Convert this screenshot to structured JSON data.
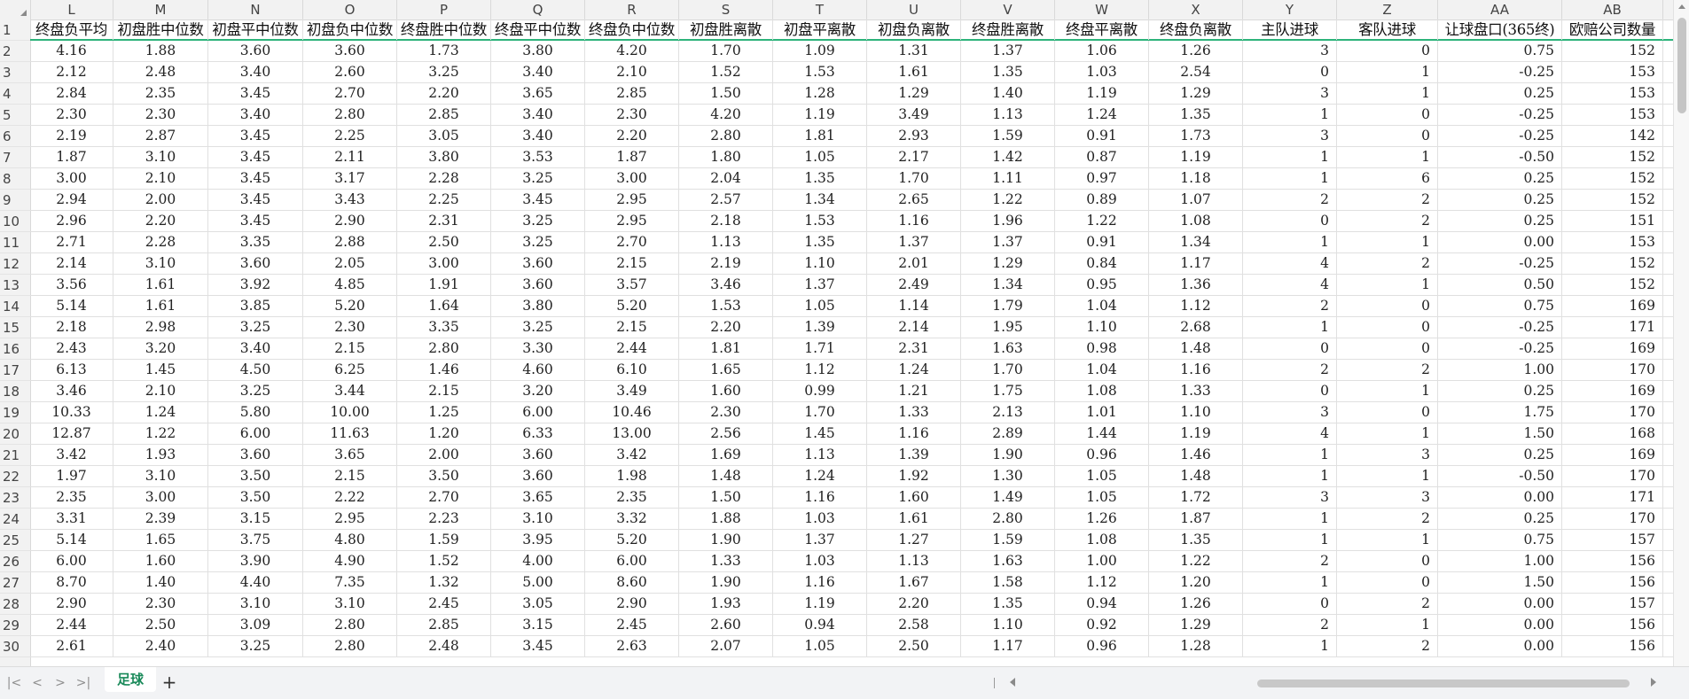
{
  "columns": [
    "L",
    "M",
    "N",
    "O",
    "P",
    "Q",
    "R",
    "S",
    "T",
    "U",
    "V",
    "W",
    "X",
    "Y",
    "Z",
    "AA",
    "AB"
  ],
  "row_numbers": [
    1,
    2,
    3,
    4,
    5,
    6,
    7,
    8,
    9,
    10,
    11,
    12,
    13,
    14,
    15,
    16,
    17,
    18,
    19,
    20,
    21,
    22,
    23,
    24,
    25,
    26,
    27,
    28,
    29,
    30
  ],
  "headers": [
    "终盘负平均",
    "初盘胜中位数",
    "初盘平中位数",
    "初盘负中位数",
    "终盘胜中位数",
    "终盘平中位数",
    "终盘负中位数",
    "初盘胜离散",
    "初盘平离散",
    "初盘负离散",
    "终盘胜离散",
    "终盘平离散",
    "终盘负离散",
    "主队进球",
    "客队进球",
    "让球盘口(365终)",
    "欧赔公司数量"
  ],
  "rows": [
    [
      "4.16",
      "1.88",
      "3.60",
      "3.60",
      "1.73",
      "3.80",
      "4.20",
      "1.70",
      "1.09",
      "1.31",
      "1.37",
      "1.06",
      "1.26",
      "3",
      "0",
      "0.75",
      "152"
    ],
    [
      "2.12",
      "2.48",
      "3.40",
      "2.60",
      "3.25",
      "3.40",
      "2.10",
      "1.52",
      "1.53",
      "1.61",
      "1.35",
      "1.03",
      "2.54",
      "0",
      "1",
      "-0.25",
      "153"
    ],
    [
      "2.84",
      "2.35",
      "3.45",
      "2.70",
      "2.20",
      "3.65",
      "2.85",
      "1.50",
      "1.28",
      "1.29",
      "1.40",
      "1.19",
      "1.29",
      "3",
      "1",
      "0.25",
      "153"
    ],
    [
      "2.30",
      "2.30",
      "3.40",
      "2.80",
      "2.85",
      "3.40",
      "2.30",
      "4.20",
      "1.19",
      "3.49",
      "1.13",
      "1.24",
      "1.35",
      "1",
      "0",
      "-0.25",
      "153"
    ],
    [
      "2.19",
      "2.87",
      "3.45",
      "2.25",
      "3.05",
      "3.40",
      "2.20",
      "2.80",
      "1.81",
      "2.93",
      "1.59",
      "0.91",
      "1.73",
      "3",
      "0",
      "-0.25",
      "142"
    ],
    [
      "1.87",
      "3.10",
      "3.45",
      "2.11",
      "3.80",
      "3.53",
      "1.87",
      "1.80",
      "1.05",
      "2.17",
      "1.42",
      "0.87",
      "1.19",
      "1",
      "1",
      "-0.50",
      "152"
    ],
    [
      "3.00",
      "2.10",
      "3.45",
      "3.17",
      "2.28",
      "3.25",
      "3.00",
      "2.04",
      "1.35",
      "1.70",
      "1.11",
      "0.97",
      "1.18",
      "1",
      "6",
      "0.25",
      "152"
    ],
    [
      "2.94",
      "2.00",
      "3.45",
      "3.43",
      "2.25",
      "3.45",
      "2.95",
      "2.57",
      "1.34",
      "2.65",
      "1.22",
      "0.89",
      "1.07",
      "2",
      "2",
      "0.25",
      "152"
    ],
    [
      "2.96",
      "2.20",
      "3.45",
      "2.90",
      "2.31",
      "3.25",
      "2.95",
      "2.18",
      "1.53",
      "1.16",
      "1.96",
      "1.22",
      "1.08",
      "0",
      "2",
      "0.25",
      "151"
    ],
    [
      "2.71",
      "2.28",
      "3.35",
      "2.88",
      "2.50",
      "3.25",
      "2.70",
      "1.13",
      "1.35",
      "1.37",
      "1.37",
      "0.91",
      "1.34",
      "1",
      "1",
      "0.00",
      "153"
    ],
    [
      "2.14",
      "3.10",
      "3.60",
      "2.05",
      "3.00",
      "3.60",
      "2.15",
      "2.19",
      "1.10",
      "2.01",
      "1.29",
      "0.84",
      "1.17",
      "4",
      "2",
      "-0.25",
      "152"
    ],
    [
      "3.56",
      "1.61",
      "3.92",
      "4.85",
      "1.91",
      "3.60",
      "3.57",
      "3.46",
      "1.37",
      "2.49",
      "1.34",
      "0.95",
      "1.36",
      "4",
      "1",
      "0.50",
      "152"
    ],
    [
      "5.14",
      "1.61",
      "3.85",
      "5.20",
      "1.64",
      "3.80",
      "5.20",
      "1.53",
      "1.05",
      "1.14",
      "1.79",
      "1.04",
      "1.12",
      "2",
      "0",
      "0.75",
      "169"
    ],
    [
      "2.18",
      "2.98",
      "3.25",
      "2.30",
      "3.35",
      "3.25",
      "2.15",
      "2.20",
      "1.39",
      "2.14",
      "1.95",
      "1.10",
      "2.68",
      "1",
      "0",
      "-0.25",
      "171"
    ],
    [
      "2.43",
      "3.20",
      "3.40",
      "2.15",
      "2.80",
      "3.30",
      "2.44",
      "1.81",
      "1.71",
      "2.31",
      "1.63",
      "0.98",
      "1.48",
      "0",
      "0",
      "-0.25",
      "169"
    ],
    [
      "6.13",
      "1.45",
      "4.50",
      "6.25",
      "1.46",
      "4.60",
      "6.10",
      "1.65",
      "1.12",
      "1.24",
      "1.70",
      "1.04",
      "1.16",
      "2",
      "2",
      "1.00",
      "170"
    ],
    [
      "3.46",
      "2.10",
      "3.25",
      "3.44",
      "2.15",
      "3.20",
      "3.49",
      "1.60",
      "0.99",
      "1.21",
      "1.75",
      "1.08",
      "1.33",
      "0",
      "1",
      "0.25",
      "169"
    ],
    [
      "10.33",
      "1.24",
      "5.80",
      "10.00",
      "1.25",
      "6.00",
      "10.46",
      "2.30",
      "1.70",
      "1.33",
      "2.13",
      "1.01",
      "1.10",
      "3",
      "0",
      "1.75",
      "170"
    ],
    [
      "12.87",
      "1.22",
      "6.00",
      "11.63",
      "1.20",
      "6.33",
      "13.00",
      "2.56",
      "1.45",
      "1.16",
      "2.89",
      "1.44",
      "1.19",
      "4",
      "1",
      "1.50",
      "168"
    ],
    [
      "3.42",
      "1.93",
      "3.60",
      "3.65",
      "2.00",
      "3.60",
      "3.42",
      "1.69",
      "1.13",
      "1.39",
      "1.90",
      "0.96",
      "1.46",
      "1",
      "3",
      "0.25",
      "169"
    ],
    [
      "1.97",
      "3.10",
      "3.50",
      "2.15",
      "3.50",
      "3.60",
      "1.98",
      "1.48",
      "1.24",
      "1.92",
      "1.30",
      "1.05",
      "1.48",
      "1",
      "1",
      "-0.50",
      "170"
    ],
    [
      "2.35",
      "3.00",
      "3.50",
      "2.22",
      "2.70",
      "3.65",
      "2.35",
      "1.50",
      "1.16",
      "1.60",
      "1.49",
      "1.05",
      "1.72",
      "3",
      "3",
      "0.00",
      "171"
    ],
    [
      "3.31",
      "2.39",
      "3.15",
      "2.95",
      "2.23",
      "3.10",
      "3.32",
      "1.88",
      "1.03",
      "1.61",
      "2.80",
      "1.26",
      "1.87",
      "1",
      "2",
      "0.25",
      "170"
    ],
    [
      "5.14",
      "1.65",
      "3.75",
      "4.80",
      "1.59",
      "3.95",
      "5.20",
      "1.90",
      "1.37",
      "1.27",
      "1.59",
      "1.08",
      "1.35",
      "1",
      "1",
      "0.75",
      "157"
    ],
    [
      "6.00",
      "1.60",
      "3.90",
      "4.90",
      "1.52",
      "4.00",
      "6.00",
      "1.33",
      "1.03",
      "1.13",
      "1.63",
      "1.00",
      "1.22",
      "2",
      "0",
      "1.00",
      "156"
    ],
    [
      "8.70",
      "1.40",
      "4.40",
      "7.35",
      "1.32",
      "5.00",
      "8.60",
      "1.90",
      "1.16",
      "1.67",
      "1.58",
      "1.12",
      "1.20",
      "1",
      "0",
      "1.50",
      "156"
    ],
    [
      "2.90",
      "2.30",
      "3.10",
      "3.10",
      "2.45",
      "3.05",
      "2.90",
      "1.93",
      "1.19",
      "2.20",
      "1.35",
      "0.94",
      "1.26",
      "0",
      "2",
      "0.00",
      "157"
    ],
    [
      "2.44",
      "2.50",
      "3.09",
      "2.80",
      "2.85",
      "3.15",
      "2.45",
      "2.60",
      "0.94",
      "2.58",
      "1.10",
      "0.92",
      "1.29",
      "2",
      "1",
      "0.00",
      "156"
    ],
    [
      "2.61",
      "2.40",
      "3.25",
      "2.80",
      "2.48",
      "3.45",
      "2.63",
      "2.07",
      "1.05",
      "2.50",
      "1.17",
      "0.96",
      "1.28",
      "1",
      "2",
      "0.00",
      "156"
    ]
  ],
  "sheet_tab": "足球",
  "add_sheet_label": "+",
  "nav": {
    "first": "|<",
    "prev": "<",
    "next": ">",
    "last": ">|"
  },
  "colors": {
    "accent": "#1a8a5a",
    "header_underline": "#2db37a",
    "gridline": "#e0e0e0",
    "chrome_bg": "#f2f2f2"
  }
}
